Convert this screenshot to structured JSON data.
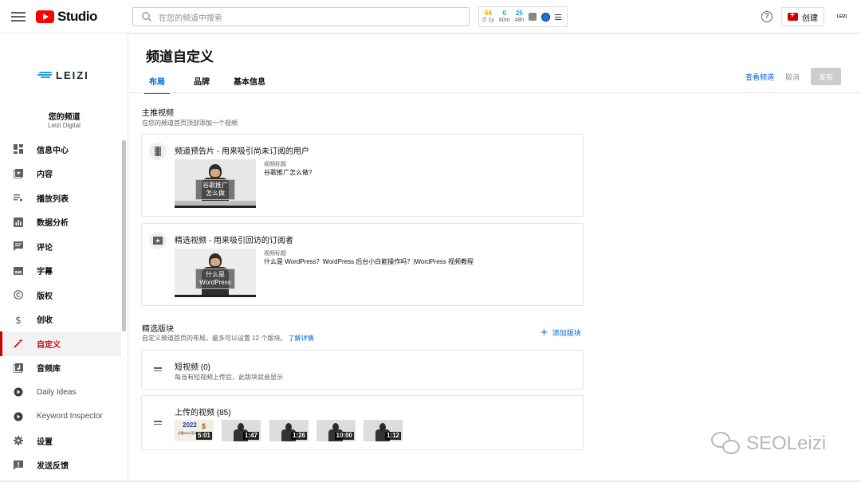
{
  "header": {
    "logo_text": "Studio",
    "search_placeholder": "在您的频道中搜索",
    "stats": [
      {
        "value": "64",
        "label": "⏱ 1y",
        "color": "#f0a500"
      },
      {
        "value": "0",
        "label": "60m",
        "color": "#1a9bdc"
      },
      {
        "value": "25",
        "label": "48h",
        "color": "#1a9bdc"
      }
    ],
    "create_label": "创建",
    "avatar_text": "LEIZI"
  },
  "sidebar": {
    "channel_logo_text": "LEIZI",
    "channel_title": "您的频道",
    "channel_name": "Leizi Digital",
    "items": [
      {
        "label": "信息中心",
        "icon": "dashboard-icon"
      },
      {
        "label": "内容",
        "icon": "content-icon"
      },
      {
        "label": "播放列表",
        "icon": "playlist-icon"
      },
      {
        "label": "数据分析",
        "icon": "analytics-icon"
      },
      {
        "label": "评论",
        "icon": "comments-icon"
      },
      {
        "label": "字幕",
        "icon": "subtitles-icon"
      },
      {
        "label": "版权",
        "icon": "copyright-icon"
      },
      {
        "label": "创收",
        "icon": "dollar-icon"
      },
      {
        "label": "自定义",
        "icon": "magic-wand-icon"
      },
      {
        "label": "音频库",
        "icon": "audio-library-icon"
      },
      {
        "label": "Daily Ideas",
        "icon": "tubebuddy-icon"
      },
      {
        "label": "Keyword Inspector",
        "icon": "tubebuddy-icon"
      },
      {
        "label": "设置",
        "icon": "settings-icon"
      },
      {
        "label": "发送反馈",
        "icon": "feedback-icon"
      }
    ]
  },
  "main": {
    "page_title": "频道自定义",
    "tabs": [
      "布局",
      "品牌",
      "基本信息"
    ],
    "actions": {
      "view": "查看频道",
      "cancel": "取消",
      "publish": "发布"
    },
    "spotlight": {
      "title": "主推视频",
      "subtitle": "在您的频道首页顶部添加一个视频",
      "trailer": {
        "title": "频道预告片 - 用来吸引尚未订阅的用户",
        "meta_label": "视频标题",
        "meta_value": "谷歌推广怎么做?",
        "thumb_caption": [
          "谷歌推广",
          "怎么做"
        ]
      },
      "featured": {
        "title": "精选视频 - 用来吸引回访的订阅者",
        "meta_label": "视频标题",
        "meta_value": "什么是 WordPress？WordPress 后台小白能操作吗？|WordPress 视频教程",
        "thumb_caption": [
          "什么是",
          "WordPress"
        ]
      }
    },
    "sections": {
      "title": "精选版块",
      "subtitle": "自定义频道首页的布局，最多可以设置 12 个版块。",
      "learn_more": "了解详情",
      "add_label": "添加版块",
      "shorts": {
        "title": "短视频 (0)",
        "desc": "每当有短视频上传后，此版块就会显示"
      },
      "uploads": {
        "title": "上传的视频 (85)",
        "first_thumb_year": "2022",
        "first_thumb_symbol": "$",
        "first_thumb_text": "谷歌ADS怎么",
        "durations": [
          "5:01",
          "1:47",
          "1:26",
          "10:00",
          "1:12"
        ]
      }
    }
  },
  "watermark": "SEOLeizi",
  "colors": {
    "accent_blue": "#065fd4",
    "active_red": "#cc0000",
    "youtube_red": "#ff0000"
  }
}
